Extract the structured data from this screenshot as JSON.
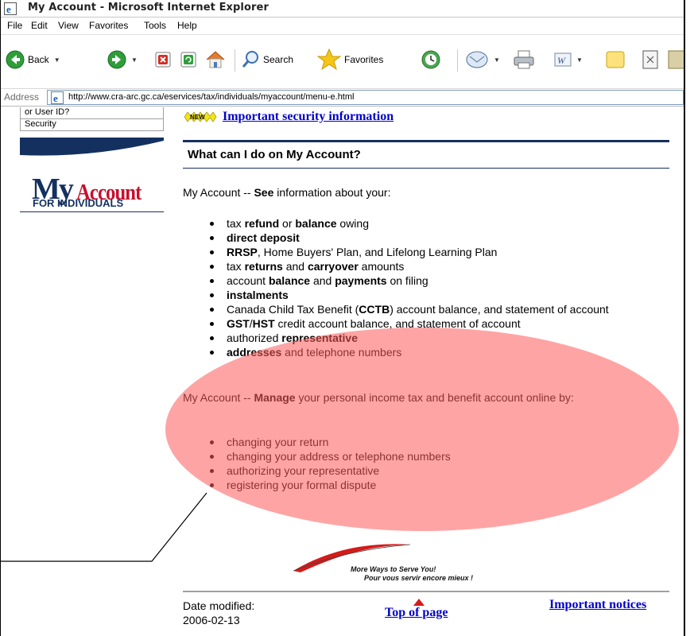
{
  "window": {
    "title": "My Account - Microsoft Internet Explorer"
  },
  "menu": [
    "File",
    "Edit",
    "View",
    "Favorites",
    "Tools",
    "Help"
  ],
  "toolbar": {
    "back_label": "Back",
    "search_label": "Search",
    "favorites_label": "Favorites"
  },
  "address": {
    "label": "Address",
    "url": "http://www.cra-arc.gc.ca/eservices/tax/individuals/myaccount/menu-e.html"
  },
  "left_nav": {
    "items": [
      "or User ID?",
      "Security"
    ],
    "logo_my": "My",
    "logo_account": "Account",
    "logo_sub": "FOR INDIVIDUALS"
  },
  "main": {
    "new_badge": "NEW",
    "security_link": "Important security information",
    "heading": "What can I do on My Account?",
    "see_intro": {
      "pre": "My Account -- ",
      "bold": "See",
      "post": " information about your:"
    },
    "see_items": [
      [
        {
          "t": "tax "
        },
        {
          "t": "refund",
          "b": true
        },
        {
          "t": " or "
        },
        {
          "t": "balance",
          "b": true
        },
        {
          "t": " owing"
        }
      ],
      [
        {
          "t": "direct deposit",
          "b": true
        }
      ],
      [
        {
          "t": "RRSP",
          "b": true
        },
        {
          "t": ", Home Buyers' Plan, and Lifelong Learning Plan"
        }
      ],
      [
        {
          "t": "tax "
        },
        {
          "t": "returns",
          "b": true
        },
        {
          "t": " and "
        },
        {
          "t": "carryover",
          "b": true
        },
        {
          "t": " amounts"
        }
      ],
      [
        {
          "t": "account "
        },
        {
          "t": "balance",
          "b": true
        },
        {
          "t": " and "
        },
        {
          "t": "payments",
          "b": true
        },
        {
          "t": " on filing"
        }
      ],
      [
        {
          "t": "instalments",
          "b": true
        }
      ],
      [
        {
          "t": "Canada Child Tax Benefit ("
        },
        {
          "t": "CCTB",
          "b": true
        },
        {
          "t": ") account balance, and statement of account"
        }
      ],
      [
        {
          "t": "GST",
          "b": true
        },
        {
          "t": "/"
        },
        {
          "t": "HST",
          "b": true
        },
        {
          "t": " credit account balance, and statement of account"
        }
      ],
      [
        {
          "t": "authorized "
        },
        {
          "t": "representative",
          "b": true
        }
      ],
      [
        {
          "t": "addresses",
          "b": true
        },
        {
          "t": " and telephone numbers"
        }
      ]
    ],
    "manage_intro": {
      "pre": "My Account -- ",
      "bold": "Manage",
      "post": " your personal income tax and benefit account online by:"
    },
    "manage_items": [
      "changing your return",
      "changing your address or telephone numbers",
      "authorizing your representative",
      "registering your formal dispute"
    ]
  },
  "banner": {
    "english": "More Ways to Serve You!",
    "french": "Pour vous servir encore mieux !"
  },
  "footer": {
    "date_label": "Date modified:",
    "date_value": "2006-02-13",
    "top_link": "Top of page",
    "notices_link": "Important notices"
  },
  "colors": {
    "link": "#0000cc",
    "navy": "#14305f",
    "brand_red": "#c8102e",
    "highlight": "#ff5a5a"
  },
  "icons": [
    "ie-logo-icon",
    "back-arrow-icon",
    "forward-arrow-icon",
    "stop-icon",
    "refresh-icon",
    "home-icon",
    "search-icon",
    "favorites-star-icon",
    "history-icon",
    "mail-icon",
    "print-icon",
    "edit-icon",
    "discuss-icon",
    "messenger-icon"
  ]
}
